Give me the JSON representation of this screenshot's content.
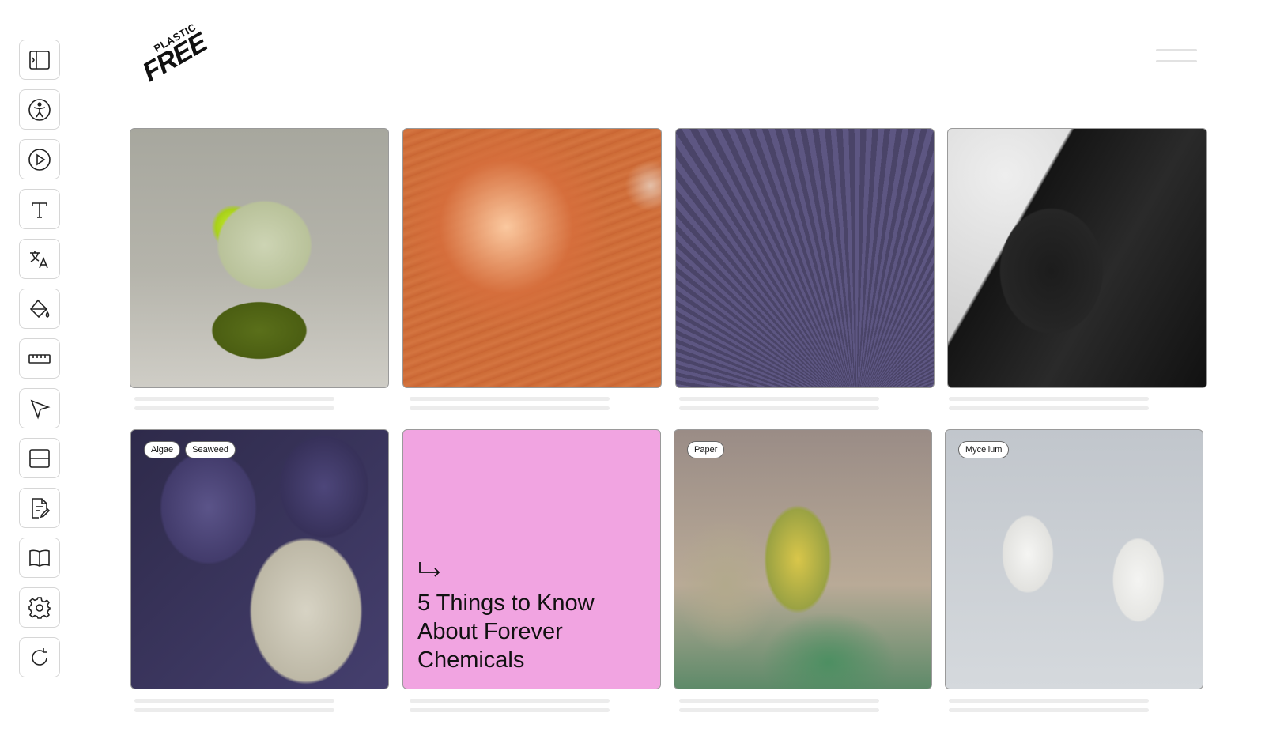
{
  "toolbar": {
    "items": [
      {
        "name": "sidebar-toggle-icon"
      },
      {
        "name": "accessibility-icon"
      },
      {
        "name": "play-icon"
      },
      {
        "name": "text-size-icon"
      },
      {
        "name": "translate-icon"
      },
      {
        "name": "color-fill-icon"
      },
      {
        "name": "ruler-icon"
      },
      {
        "name": "cursor-icon"
      },
      {
        "name": "reading-mask-icon"
      },
      {
        "name": "document-edit-icon"
      },
      {
        "name": "book-icon"
      },
      {
        "name": "gear-icon"
      },
      {
        "name": "reset-icon"
      }
    ]
  },
  "logo": {
    "line1": "PLASTIC",
    "line2": "FREE",
    "registered": "®"
  },
  "menu": {
    "icon": "hamburger-menu-icon"
  },
  "cards": [
    {
      "id": "sculpture",
      "tags": []
    },
    {
      "id": "droplet",
      "tags": []
    },
    {
      "id": "mushroom",
      "tags": []
    },
    {
      "id": "fashion",
      "tags": []
    },
    {
      "id": "yarn",
      "tags": [
        "Algae",
        "Seaweed"
      ]
    },
    {
      "id": "article",
      "title": "5 Things to Know About Forever Chemicals",
      "icon": "arrow-down-right-icon"
    },
    {
      "id": "paper",
      "tags": [
        "Paper"
      ]
    },
    {
      "id": "mycelium",
      "tags": [
        "Mycelium"
      ]
    }
  ]
}
